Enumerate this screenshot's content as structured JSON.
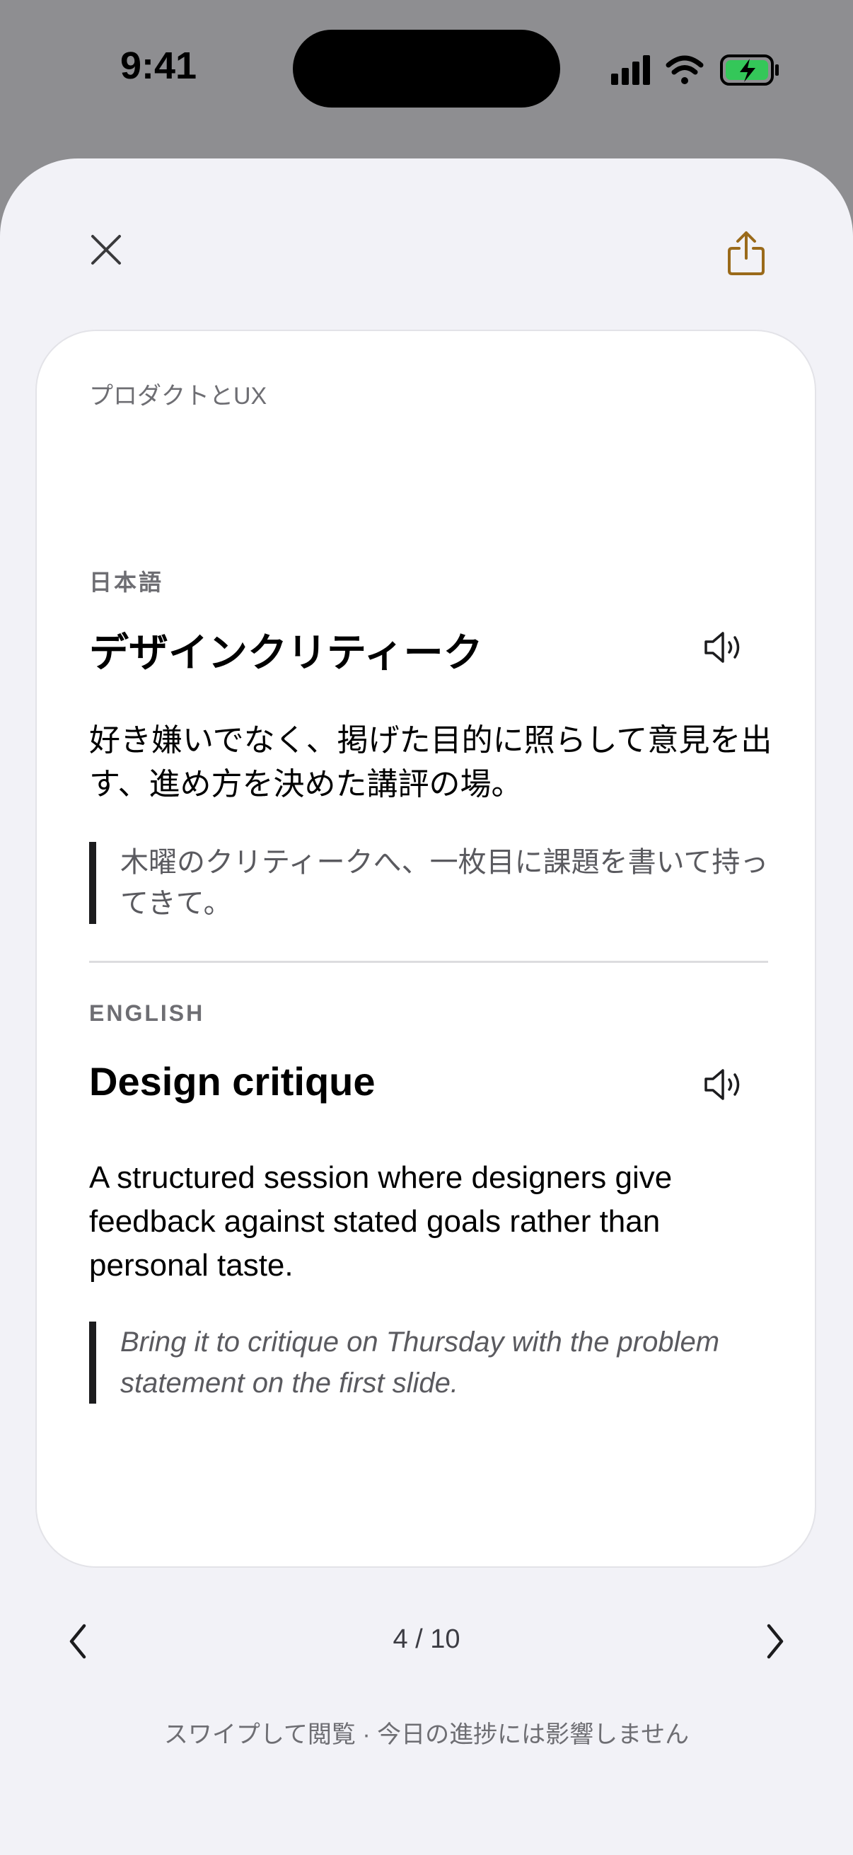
{
  "status_bar": {
    "time": "9:41",
    "icons": [
      "cellular-signal-icon",
      "wifi-icon",
      "battery-charging-icon"
    ],
    "battery_color": "#34c759"
  },
  "header": {
    "close_icon": "close-icon",
    "share_icon": "share-icon",
    "accent_color": "#9a6a1a"
  },
  "card": {
    "category": "プロダクトとUX",
    "japanese": {
      "label": "日本語",
      "term": "デザインクリティーク",
      "definition": "好き嫌いでなく、掲げた目的に照らして意見を出す、進め方を決めた講評の場。",
      "example": "木曜のクリティークへ、一枚目に課題を書いて持ってきて。"
    },
    "english": {
      "label": "ENGLISH",
      "term": "Design critique",
      "definition": "A structured session where designers give feedback against stated goals rather than personal taste.",
      "example": "Bring it to critique on Thursday with the problem statement on the first slide."
    }
  },
  "pager": {
    "counter": "4 / 10",
    "prev_icon": "chevron-left-icon",
    "next_icon": "chevron-right-icon"
  },
  "hint": "スワイプして閲覧 · 今日の進捗には影響しません"
}
